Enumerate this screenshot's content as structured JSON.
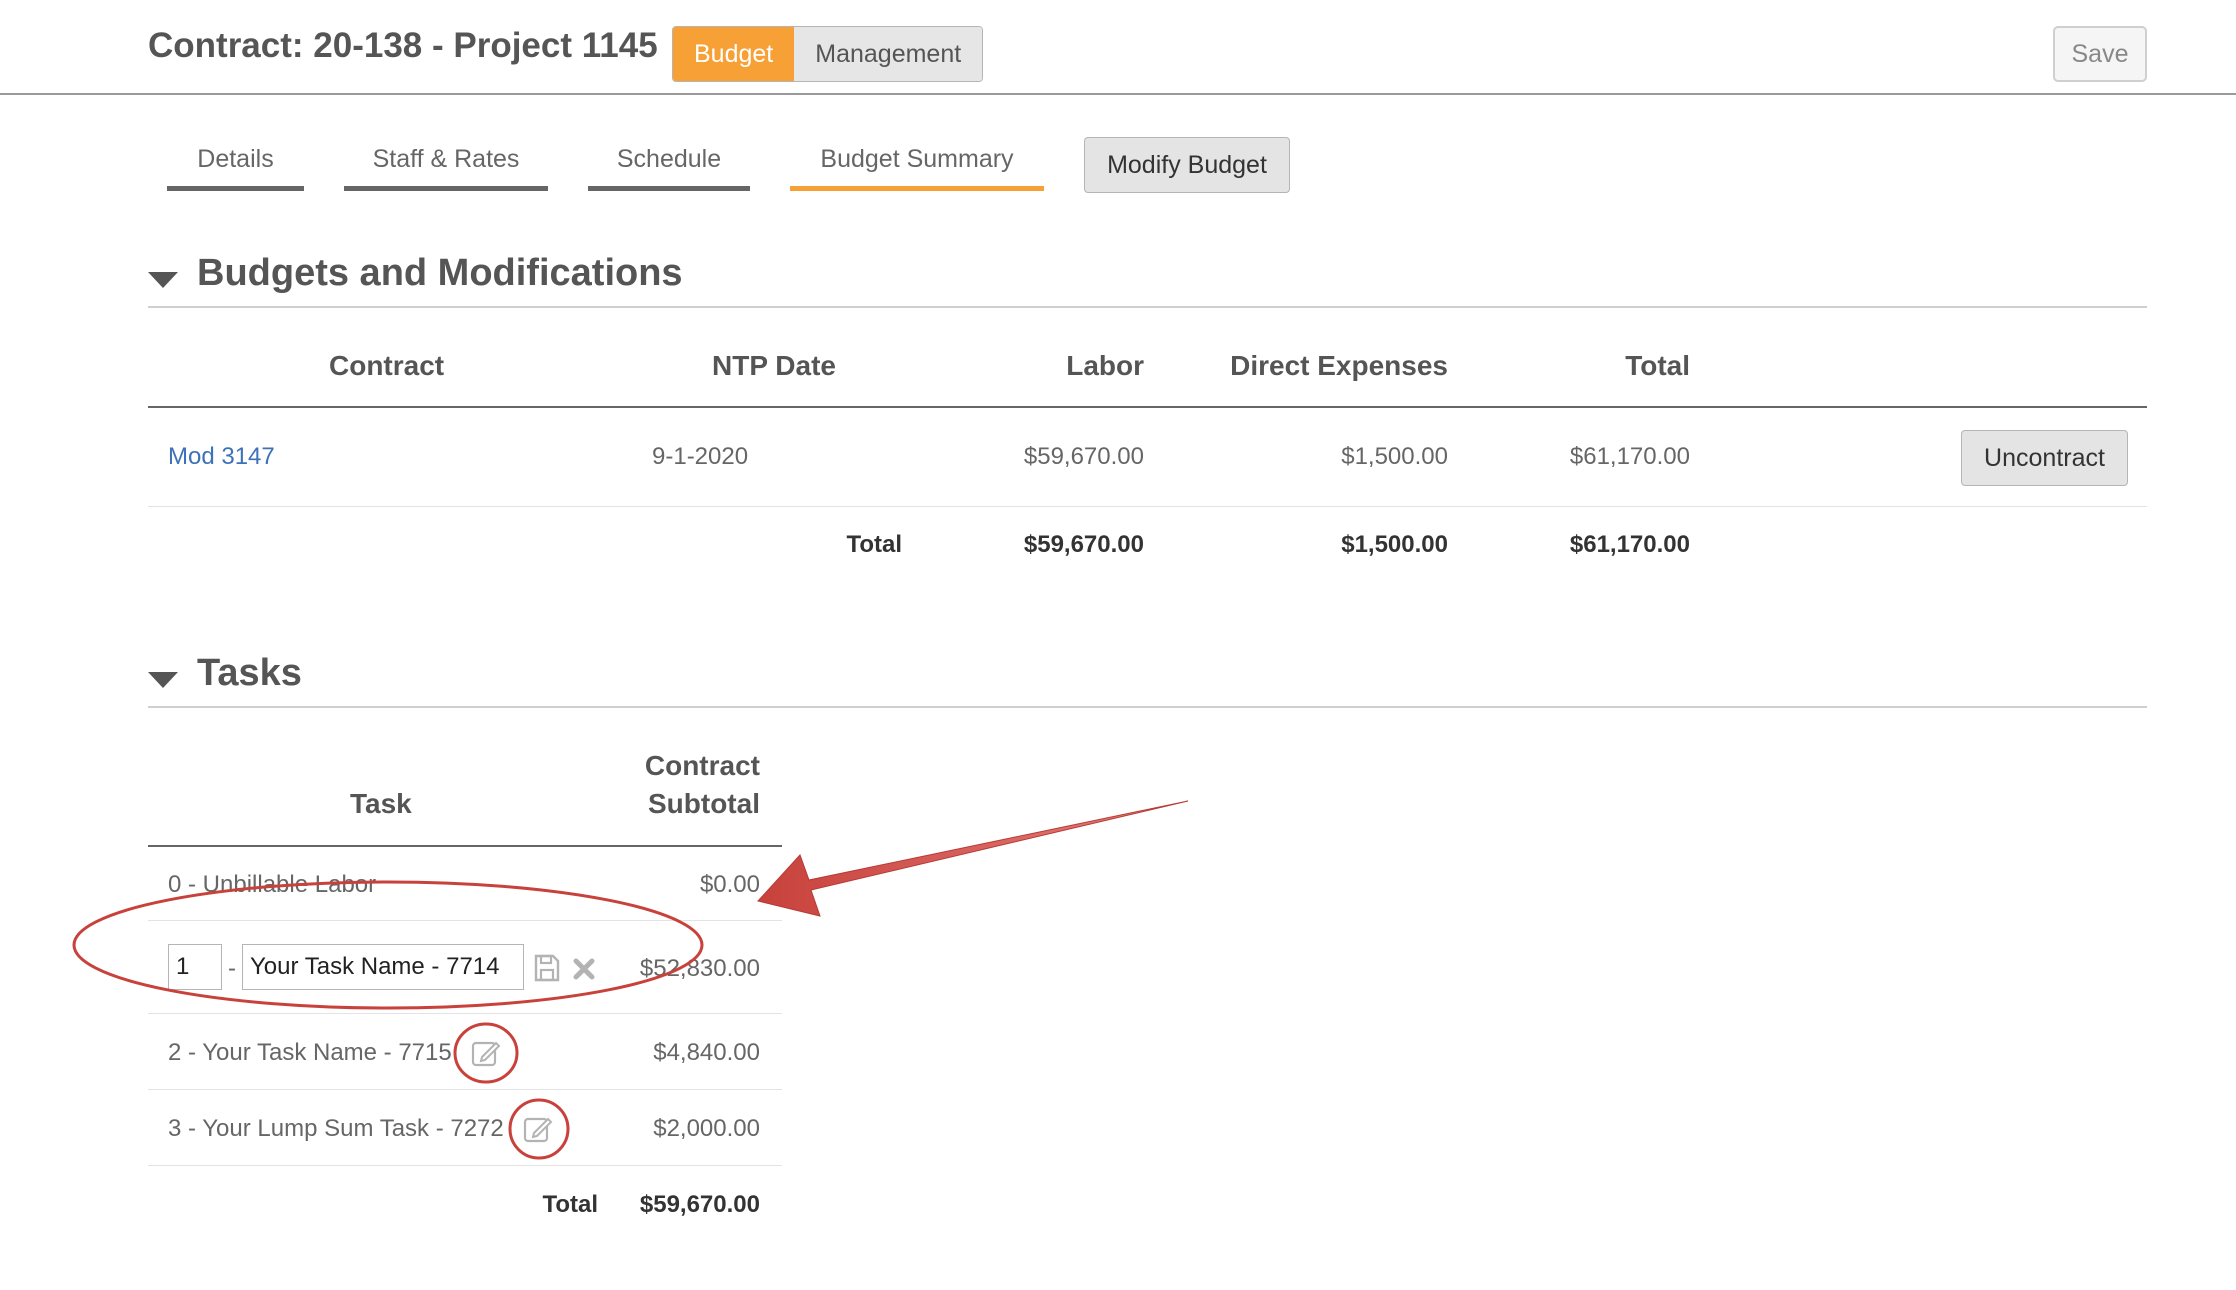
{
  "header": {
    "title": "Contract: 20-138 - Project 1145",
    "toggle": {
      "budget": "Budget",
      "management": "Management"
    },
    "save_label": "Save"
  },
  "tabs": [
    {
      "label": "Details"
    },
    {
      "label": "Staff & Rates"
    },
    {
      "label": "Schedule"
    },
    {
      "label": "Budget Summary",
      "active": true
    }
  ],
  "modify_budget_label": "Modify Budget",
  "budgets": {
    "title": "Budgets and Modifications",
    "columns": {
      "contract": "Contract",
      "ntp_date": "NTP Date",
      "labor": "Labor",
      "direct_expenses": "Direct Expenses",
      "total": "Total"
    },
    "rows": [
      {
        "contract": "Mod 3147",
        "ntp_date": "9-1-2020",
        "labor": "$59,670.00",
        "direct_expenses": "$1,500.00",
        "total": "$61,170.00",
        "action": "Uncontract"
      }
    ],
    "totals": {
      "label": "Total",
      "labor": "$59,670.00",
      "direct_expenses": "$1,500.00",
      "total": "$61,170.00"
    }
  },
  "tasks": {
    "title": "Tasks",
    "columns": {
      "task": "Task",
      "subtotal_line1": "Contract",
      "subtotal_line2": "Subtotal"
    },
    "rows": [
      {
        "label": "0 - Unbillable Labor",
        "subtotal": "$0.00"
      },
      {
        "number": "1",
        "separator": "-",
        "name": "Your Task Name - 7714",
        "subtotal": "$52,830.00",
        "editing": true
      },
      {
        "label": "2 - Your Task Name - 7715",
        "subtotal": "$4,840.00"
      },
      {
        "label": "3 - Your Lump Sum Task - 7272",
        "subtotal": "$2,000.00"
      }
    ],
    "totals": {
      "label": "Total",
      "value": "$59,670.00"
    }
  },
  "icons": {
    "caret": "caret-down-icon",
    "save": "floppy-disk-icon",
    "cancel": "close-icon",
    "edit": "edit-icon"
  },
  "colors": {
    "accent": "#f7a035",
    "link": "#3d72b8",
    "annotation": "#c8413b"
  }
}
